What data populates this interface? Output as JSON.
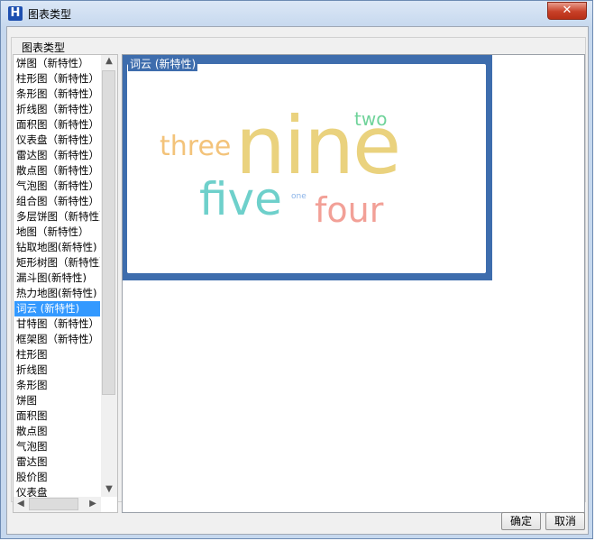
{
  "window": {
    "title": "图表类型"
  },
  "group": {
    "label": "图表类型"
  },
  "list": {
    "items": [
      "饼图（新特性）",
      "柱形图（新特性）",
      "条形图（新特性）",
      "折线图（新特性）",
      "面积图（新特性）",
      "仪表盘（新特性）",
      "雷达图（新特性）",
      "散点图（新特性）",
      "气泡图（新特性）",
      "组合图（新特性）",
      "多层饼图（新特性）",
      "地图（新特性）",
      "钻取地图(新特性)",
      "矩形树图（新特性）",
      "漏斗图(新特性)",
      "热力地图(新特性)",
      "词云 (新特性)",
      "甘特图（新特性）",
      "框架图（新特性）",
      "柱形图",
      "折线图",
      "条形图",
      "饼图",
      "面积图",
      "散点图",
      "气泡图",
      "雷达图",
      "股价图",
      "仪表盘"
    ],
    "selected_index": 16
  },
  "preview": {
    "title": "词云 (新特性)",
    "words": [
      {
        "text": "nine",
        "color": "#ead27e"
      },
      {
        "text": "two",
        "color": "#6fd39a"
      },
      {
        "text": "three",
        "color": "#f3c37a"
      },
      {
        "text": "five",
        "color": "#6ed0cb"
      },
      {
        "text": "one",
        "color": "#8ab3e8"
      },
      {
        "text": "four",
        "color": "#f2a097"
      }
    ]
  },
  "buttons": {
    "ok": "确定",
    "cancel": "取消"
  },
  "icons": {
    "app": "H",
    "close": "✕"
  }
}
